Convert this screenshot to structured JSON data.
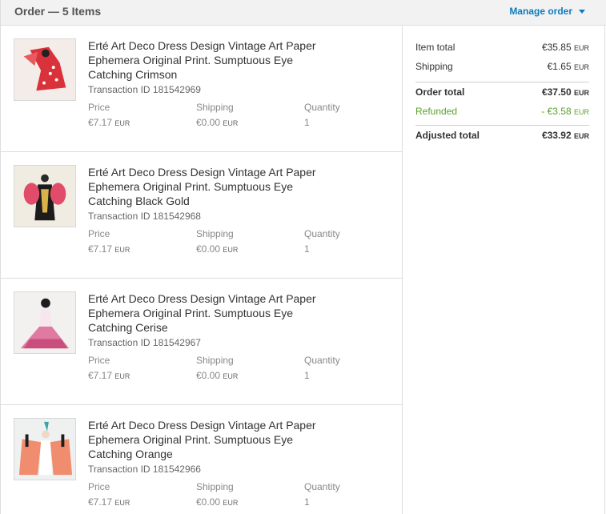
{
  "header": {
    "title": "Order — 5 Items",
    "manage_label": "Manage order"
  },
  "items": [
    {
      "title": "Erté Art Deco Dress Design Vintage Art Paper Ephemera Original Print. Sumptuous Eye Catching Crimson",
      "transaction": "Transaction ID 181542969",
      "price_label": "Price",
      "price": "€7.17",
      "price_cur": "EUR",
      "ship_label": "Shipping",
      "ship": "€0.00",
      "ship_cur": "EUR",
      "qty_label": "Quantity",
      "qty": "1",
      "accent": "#d9323a"
    },
    {
      "title": "Erté Art Deco Dress Design Vintage Art Paper Ephemera Original Print. Sumptuous Eye Catching Black Gold",
      "transaction": "Transaction ID 181542968",
      "price_label": "Price",
      "price": "€7.17",
      "price_cur": "EUR",
      "ship_label": "Shipping",
      "ship": "€0.00",
      "ship_cur": "EUR",
      "qty_label": "Quantity",
      "qty": "1",
      "accent": "#1c1c1c"
    },
    {
      "title": "Erté Art Deco Dress Design Vintage Art Paper Ephemera Original Print. Sumptuous Eye Catching Cerise",
      "transaction": "Transaction ID 181542967",
      "price_label": "Price",
      "price": "€7.17",
      "price_cur": "EUR",
      "ship_label": "Shipping",
      "ship": "€0.00",
      "ship_cur": "EUR",
      "qty_label": "Quantity",
      "qty": "1",
      "accent": "#e07aa0"
    },
    {
      "title": "Erté Art Deco Dress Design Vintage Art Paper Ephemera Original Print. Sumptuous Eye Catching Orange",
      "transaction": "Transaction ID 181542966",
      "price_label": "Price",
      "price": "€7.17",
      "price_cur": "EUR",
      "ship_label": "Shipping",
      "ship": "€0.00",
      "ship_cur": "EUR",
      "qty_label": "Quantity",
      "qty": "1",
      "accent": "#f08d6e"
    }
  ],
  "summary": {
    "item_total_label": "Item total",
    "item_total": "€35.85",
    "item_total_cur": "EUR",
    "shipping_label": "Shipping",
    "shipping": "€1.65",
    "shipping_cur": "EUR",
    "order_total_label": "Order total",
    "order_total": "€37.50",
    "order_total_cur": "EUR",
    "refunded_label": "Refunded",
    "refunded": "- €3.58",
    "refunded_cur": "EUR",
    "adjusted_label": "Adjusted total",
    "adjusted": "€33.92",
    "adjusted_cur": "EUR"
  },
  "colors": {
    "link": "#0f7bbd",
    "refund_green": "#5aa02c",
    "header_bg": "#f2f2f2"
  }
}
